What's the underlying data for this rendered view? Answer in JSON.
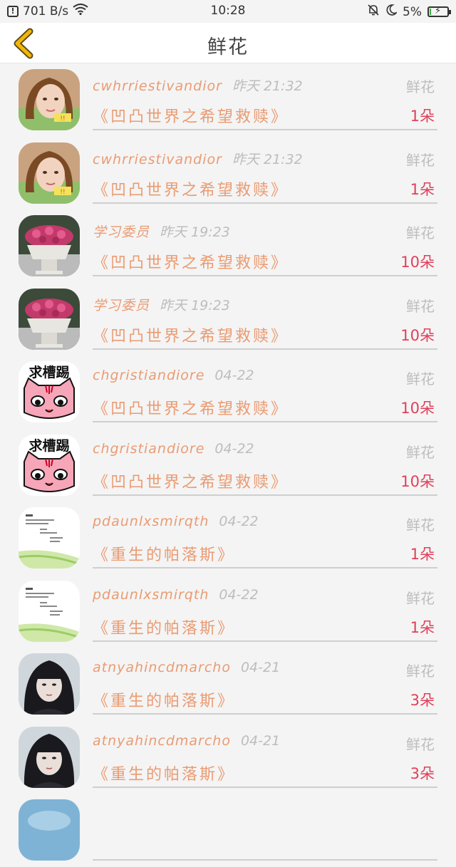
{
  "status_bar": {
    "speed": "701 B/s",
    "time": "10:28",
    "battery": "5%",
    "battery_level": 0.05
  },
  "header": {
    "title": "鲜花",
    "back_icon": "chevron-left-icon"
  },
  "items": [
    {
      "name": "cwhrriestivandior",
      "time": "昨天 21:32",
      "type": "鲜花",
      "book": "《凹凸世界之希望救赎》",
      "count": "1朵",
      "avatar": "girl-photo"
    },
    {
      "name": "cwhrriestivandior",
      "time": "昨天 21:32",
      "type": "鲜花",
      "book": "《凹凸世界之希望救赎》",
      "count": "1朵",
      "avatar": "girl-photo"
    },
    {
      "name": "学习委员",
      "time": "昨天 19:23",
      "type": "鲜花",
      "book": "《凹凸世界之希望救赎》",
      "count": "10朵",
      "avatar": "flower-pot-photo"
    },
    {
      "name": "学习委员",
      "time": "昨天 19:23",
      "type": "鲜花",
      "book": "《凹凸世界之希望救赎》",
      "count": "10朵",
      "avatar": "flower-pot-photo"
    },
    {
      "name": "chgristiandiore",
      "time": "04-22",
      "type": "鲜花",
      "book": "《凹凸世界之希望救赎》",
      "count": "10朵",
      "avatar": "cartoon-cat",
      "avatar_text": "求槽踢"
    },
    {
      "name": "chgristiandiore",
      "time": "04-22",
      "type": "鲜花",
      "book": "《凹凸世界之希望救赎》",
      "count": "10朵",
      "avatar": "cartoon-cat",
      "avatar_text": "求槽踢"
    },
    {
      "name": "pdaunlxsmirqth",
      "time": "04-22",
      "type": "鲜花",
      "book": "《重生的帕落斯》",
      "count": "1朵",
      "avatar": "text-note"
    },
    {
      "name": "pdaunlxsmirqth",
      "time": "04-22",
      "type": "鲜花",
      "book": "《重生的帕落斯》",
      "count": "1朵",
      "avatar": "text-note"
    },
    {
      "name": "atnyahincdmarcho",
      "time": "04-21",
      "type": "鲜花",
      "book": "《重生的帕落斯》",
      "count": "3朵",
      "avatar": "dark-hair-photo"
    },
    {
      "name": "atnyahincdmarcho",
      "time": "04-21",
      "type": "鲜花",
      "book": "《重生的帕落斯》",
      "count": "3朵",
      "avatar": "dark-hair-photo"
    },
    {
      "name": "",
      "time": "",
      "type": "",
      "book": "",
      "count": "",
      "avatar": "blue-photo"
    }
  ],
  "colors": {
    "accent": "#ea9b72",
    "count": "#e0405a",
    "muted": "#bdbdbd",
    "back_icon": "#f2b705"
  }
}
